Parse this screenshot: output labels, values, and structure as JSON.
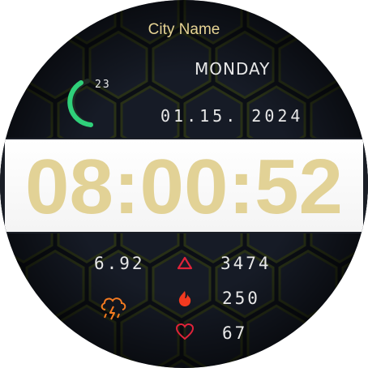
{
  "watch_face": {
    "city": "City Name",
    "weekday": "MONDAY",
    "date": "01.15. 2024",
    "time": "08:00:52",
    "battery": {
      "value": "23",
      "level": 0.23
    },
    "distance": "6.92",
    "steps": "3474",
    "calories": "250",
    "heart_rate": "67"
  },
  "colors": {
    "accent_gold": "#e6d394",
    "time_digits": "#e2d296",
    "battery_green": "#2fd07a",
    "icon_red": "#e0233a",
    "calorie_red": "#f23a20",
    "weather_orange": "#f47a20",
    "text_white": "#e8e8e8"
  },
  "icons": {
    "steps": "triangle-outline-icon",
    "calories": "flame-icon",
    "heart_rate": "heart-outline-icon",
    "weather": "thunderstorm-cloud-icon"
  }
}
